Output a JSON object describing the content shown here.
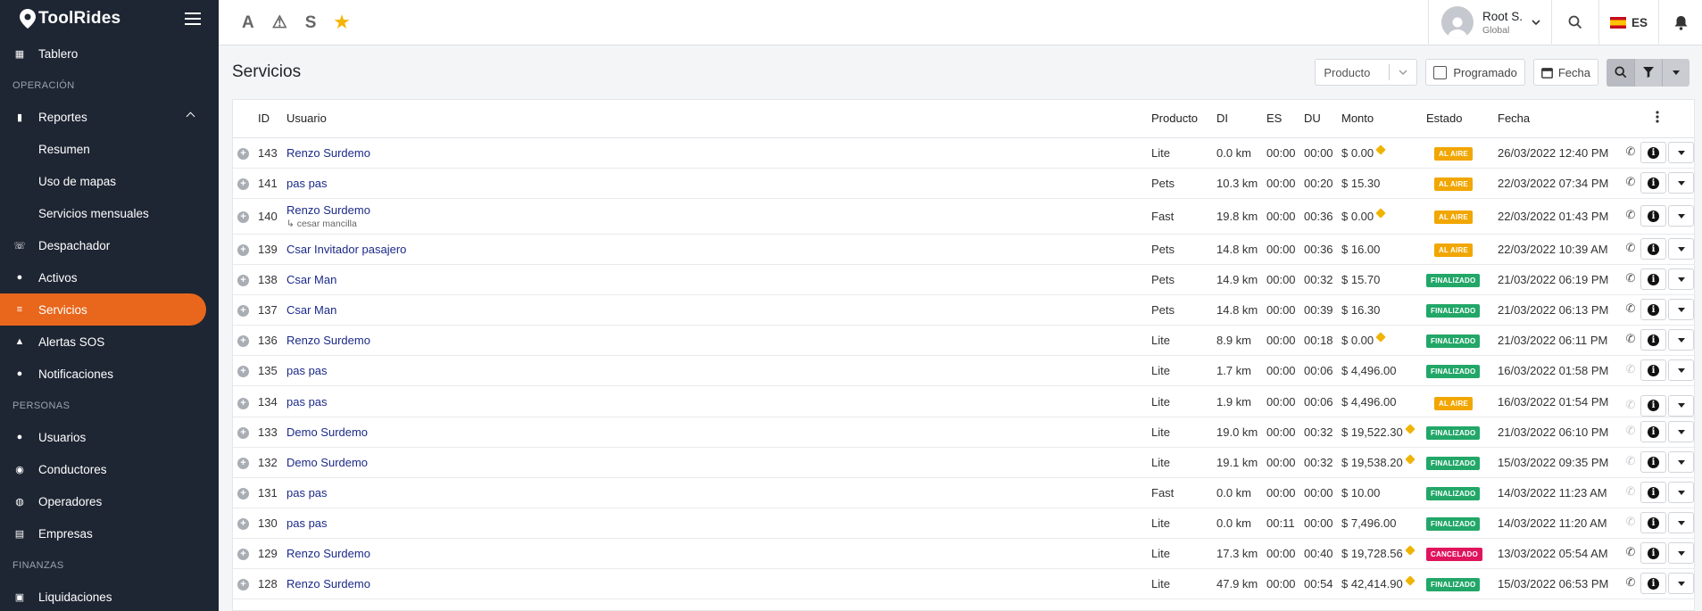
{
  "app": {
    "logo_text": "ToolRides"
  },
  "sidebar": {
    "items": [
      {
        "kind": "item",
        "label": "Tablero",
        "icon": "dashboard-icon",
        "glyph": "▦"
      },
      {
        "kind": "section",
        "label": "OPERACIÓN"
      },
      {
        "kind": "item",
        "label": "Reportes",
        "icon": "chart-icon",
        "glyph": "▮",
        "expanded": true
      },
      {
        "kind": "sub",
        "label": "Resumen"
      },
      {
        "kind": "sub",
        "label": "Uso de mapas"
      },
      {
        "kind": "sub",
        "label": "Servicios mensuales"
      },
      {
        "kind": "item",
        "label": "Despachador",
        "icon": "phone-icon",
        "glyph": "☏"
      },
      {
        "kind": "item",
        "label": "Activos",
        "icon": "activity-icon",
        "glyph": "●"
      },
      {
        "kind": "item",
        "label": "Servicios",
        "icon": "list-icon",
        "glyph": "≡",
        "active": true
      },
      {
        "kind": "item",
        "label": "Alertas SOS",
        "icon": "warning-icon",
        "glyph": "▲"
      },
      {
        "kind": "item",
        "label": "Notificaciones",
        "icon": "bell-icon",
        "glyph": "●"
      },
      {
        "kind": "section",
        "label": "PERSONAS"
      },
      {
        "kind": "item",
        "label": "Usuarios",
        "icon": "users-icon",
        "glyph": "●"
      },
      {
        "kind": "item",
        "label": "Conductores",
        "icon": "steering-icon",
        "glyph": "◉"
      },
      {
        "kind": "item",
        "label": "Operadores",
        "icon": "globe-icon",
        "glyph": "◍"
      },
      {
        "kind": "item",
        "label": "Empresas",
        "icon": "building-icon",
        "glyph": "▤"
      },
      {
        "kind": "section",
        "label": "FINANZAS"
      },
      {
        "kind": "item",
        "label": "Liquidaciones",
        "icon": "wallet-icon",
        "glyph": "▣"
      }
    ]
  },
  "topbar": {
    "quick": [
      {
        "name": "font-a-icon",
        "glyph": "A"
      },
      {
        "name": "warning-icon",
        "glyph": "⚠"
      },
      {
        "name": "letter-s-icon",
        "glyph": "S"
      },
      {
        "name": "star-icon",
        "glyph": "★",
        "color": "#f4b400"
      }
    ],
    "user_name": "Root S.",
    "user_role": "Global",
    "lang": "ES"
  },
  "page": {
    "title": "Servicios",
    "product_placeholder": "Producto",
    "programado_label": "Programado",
    "fecha_label": "Fecha"
  },
  "table": {
    "columns": [
      "ID",
      "Usuario",
      "Producto",
      "DI",
      "ES",
      "DU",
      "Monto",
      "Estado",
      "Fecha"
    ],
    "rows": [
      {
        "id": "143",
        "user": "Renzo Surdemo",
        "sub": "",
        "product": "Lite",
        "di": "0.0 km",
        "es": "00:00",
        "du": "00:00",
        "amount": "$ 0.00",
        "tag": true,
        "status": "AL AIRE",
        "status_type": "aire",
        "date": "26/03/2022 12:40 PM",
        "phone": true
      },
      {
        "id": "141",
        "user": "pas pas",
        "sub": "",
        "product": "Pets",
        "di": "10.3 km",
        "es": "00:00",
        "du": "00:20",
        "amount": "$ 15.30",
        "tag": false,
        "status": "AL AIRE",
        "status_type": "aire",
        "date": "22/03/2022 07:34 PM",
        "phone": true
      },
      {
        "id": "140",
        "user": "Renzo Surdemo",
        "sub": "↳ cesar mancilla",
        "product": "Fast",
        "di": "19.8 km",
        "es": "00:00",
        "du": "00:36",
        "amount": "$ 0.00",
        "tag": true,
        "status": "AL AIRE",
        "status_type": "aire",
        "date": "22/03/2022 01:43 PM",
        "phone": true
      },
      {
        "id": "139",
        "user": "Csar Invitador pasajero",
        "sub": "",
        "product": "Pets",
        "di": "14.8 km",
        "es": "00:00",
        "du": "00:36",
        "amount": "$ 16.00",
        "tag": false,
        "status": "AL AIRE",
        "status_type": "aire",
        "date": "22/03/2022 10:39 AM",
        "phone": true
      },
      {
        "id": "138",
        "user": "Csar Man",
        "sub": "",
        "product": "Pets",
        "di": "14.9 km",
        "es": "00:00",
        "du": "00:32",
        "amount": "$ 15.70",
        "tag": false,
        "status": "FINALIZADO",
        "status_type": "fin",
        "date": "21/03/2022 06:19 PM",
        "phone": true
      },
      {
        "id": "137",
        "user": "Csar Man",
        "sub": "",
        "product": "Pets",
        "di": "14.8 km",
        "es": "00:00",
        "du": "00:39",
        "amount": "$ 16.30",
        "tag": false,
        "status": "FINALIZADO",
        "status_type": "fin",
        "date": "21/03/2022 06:13 PM",
        "phone": true
      },
      {
        "id": "136",
        "user": "Renzo Surdemo",
        "sub": "",
        "product": "Lite",
        "di": "8.9 km",
        "es": "00:00",
        "du": "00:18",
        "amount": "$ 0.00",
        "tag": true,
        "status": "FINALIZADO",
        "status_type": "fin",
        "date": "21/03/2022 06:11 PM",
        "phone": true
      },
      {
        "id": "135",
        "user": "pas pas",
        "sub": "",
        "product": "Lite",
        "di": "1.7 km",
        "es": "00:00",
        "du": "00:06",
        "amount": "$ 4,496.00",
        "tag": false,
        "status": "FINALIZADO",
        "status_type": "fin",
        "date": "16/03/2022 01:58 PM",
        "phone": false
      },
      {
        "id": "134",
        "user": "pas pas",
        "sub": "",
        "product": "Lite",
        "di": "1.9 km",
        "es": "00:00",
        "du": "00:06",
        "amount": "$ 4,496.00",
        "tag": false,
        "status": "AL AIRE",
        "status_type": "aire",
        "date": "16/03/2022 01:54 PM",
        "phone": false,
        "clip": true
      },
      {
        "id": "133",
        "user": "Demo Surdemo",
        "sub": "",
        "product": "Lite",
        "di": "19.0 km",
        "es": "00:00",
        "du": "00:32",
        "amount": "$ 19,522.30",
        "tag": true,
        "status": "FINALIZADO",
        "status_type": "fin",
        "date": "21/03/2022 06:10 PM",
        "phone": false
      },
      {
        "id": "132",
        "user": "Demo Surdemo",
        "sub": "",
        "product": "Lite",
        "di": "19.1 km",
        "es": "00:00",
        "du": "00:32",
        "amount": "$ 19,538.20",
        "tag": true,
        "status": "FINALIZADO",
        "status_type": "fin",
        "date": "15/03/2022 09:35 PM",
        "phone": false
      },
      {
        "id": "131",
        "user": "pas pas",
        "sub": "",
        "product": "Fast",
        "di": "0.0 km",
        "es": "00:00",
        "du": "00:00",
        "amount": "$ 10.00",
        "tag": false,
        "status": "FINALIZADO",
        "status_type": "fin",
        "date": "14/03/2022 11:23 AM",
        "phone": false
      },
      {
        "id": "130",
        "user": "pas pas",
        "sub": "",
        "product": "Lite",
        "di": "0.0 km",
        "es": "00:11",
        "du": "00:00",
        "amount": "$ 7,496.00",
        "tag": false,
        "status": "FINALIZADO",
        "status_type": "fin",
        "date": "14/03/2022 11:20 AM",
        "phone": false
      },
      {
        "id": "129",
        "user": "Renzo Surdemo",
        "sub": "",
        "product": "Lite",
        "di": "17.3 km",
        "es": "00:00",
        "du": "00:40",
        "amount": "$ 19,728.56",
        "tag": true,
        "status": "CANCELADO",
        "status_type": "can",
        "date": "13/03/2022 05:54 AM",
        "phone": true
      },
      {
        "id": "128",
        "user": "Renzo Surdemo",
        "sub": "",
        "product": "Lite",
        "di": "47.9 km",
        "es": "00:00",
        "du": "00:54",
        "amount": "$ 42,414.90",
        "tag": true,
        "status": "FINALIZADO",
        "status_type": "fin",
        "date": "15/03/2022 06:53 PM",
        "phone": true
      }
    ]
  },
  "colors": {
    "sidebar_bg": "#1e2533",
    "accent": "#e8671c",
    "link": "#1b2a88",
    "aire": "#f1a600",
    "finalizado": "#22a768",
    "cancelado": "#e0145d"
  }
}
